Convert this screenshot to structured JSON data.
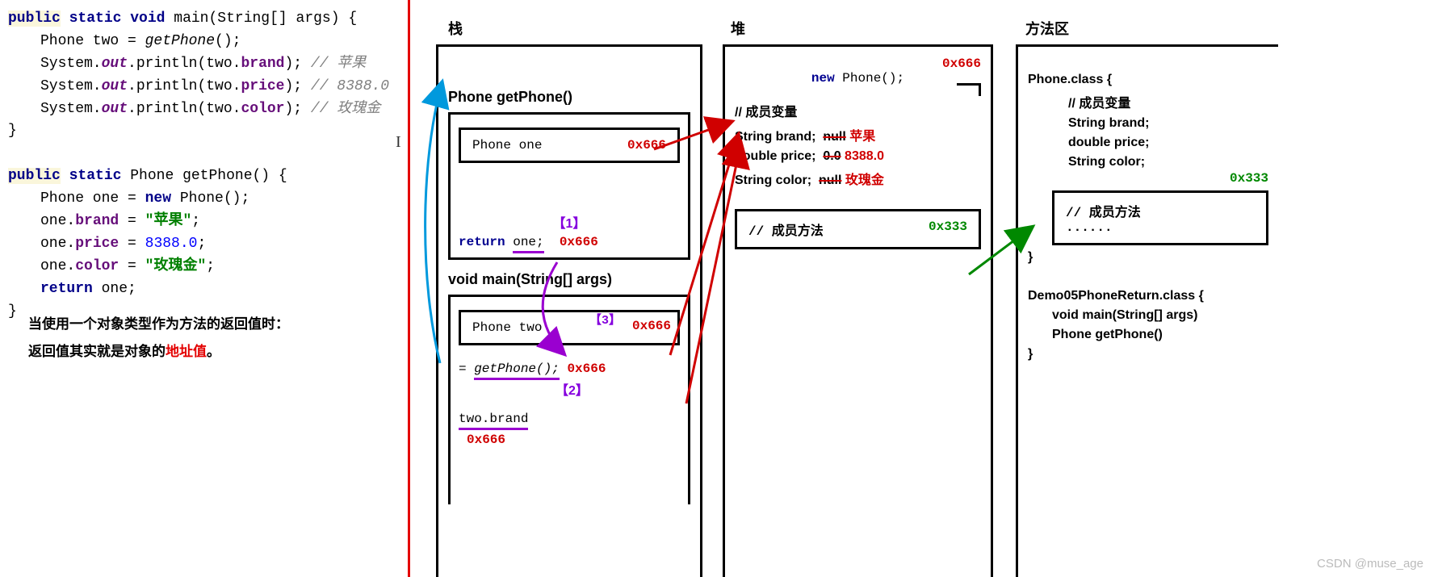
{
  "code": {
    "main_sig": {
      "public": "public",
      "static": "static",
      "void": "void",
      "main": "main",
      "args": "(String[] args) {"
    },
    "l1a": "Phone two = ",
    "l1b": "getPhone",
    "l1c": "();",
    "l2a": "System.",
    "l2out": "out",
    "l2b": ".println(two.",
    "brand": "brand",
    "l2c": "); ",
    "c1": "// 苹果",
    "price": "price",
    "c2": "// 8388.0",
    "color": "color",
    "c3": "// 玫瑰金",
    "close": "}",
    "gp_sig": {
      "public": "public",
      "static": "static",
      "type": "Phone",
      "name": "getPhone",
      "p": "() {"
    },
    "g1a": "Phone one = ",
    "g1new": "new ",
    "g1b": "Phone();",
    "g2a": "one.",
    "g2f": "brand",
    "g2b": " = ",
    "g2v": "\"苹果\"",
    "g2c": ";",
    "g3a": "one.",
    "g3f": "price",
    "g3b": " = ",
    "g3v": "8388.0",
    "g3c": ";",
    "g4a": "one.",
    "g4f": "color",
    "g4b": " = ",
    "g4v": "\"玫瑰金\"",
    "g4c": ";",
    "g5a": "return ",
    "g5b": "one;"
  },
  "note": {
    "l1": "当使用一个对象类型作为方法的返回值时：",
    "l2a": "返回值其实就是对象的",
    "l2b": "地址值",
    "l2c": "。"
  },
  "labels": {
    "stack": "栈",
    "heap": "堆",
    "method_area": "方法区"
  },
  "stack": {
    "gp_title": "Phone getPhone()",
    "one_label": "Phone one",
    "addr": "0x666",
    "step1": "【1】",
    "return": "return ",
    "one": "one;",
    "main_title": "void main(String[] args)",
    "two_label": "Phone two",
    "step3": "【3】",
    "eq": "= ",
    "getphone": "getPhone();",
    "step2": "【2】",
    "twobrand": "two.brand",
    "addr2": "0x666"
  },
  "heap": {
    "new": "new ",
    "phone": "Phone();",
    "addr": "0x666",
    "members_title": "// 成员变量",
    "brand_l": "String brand;",
    "brand_old": "null",
    "brand_new": "苹果",
    "price_l": "double price;",
    "price_old": "0.0",
    "price_new": "8388.0",
    "color_l": "String color;",
    "color_old": "null",
    "color_new": "玫瑰金",
    "methods_title": "// 成员方法",
    "methods_addr": "0x333"
  },
  "ma": {
    "pc_title": "Phone.class {",
    "members": "// 成员变量",
    "brand": "String brand;",
    "price": "double price;",
    "color": "String color;",
    "addr": "0x333",
    "methods": "// 成员方法",
    "dots": "......",
    "close": "}",
    "demo_title": "Demo05PhoneReturn.class {",
    "demo_main": "void main(String[] args)",
    "demo_gp": "Phone getPhone()"
  },
  "watermark": "CSDN @muse_age"
}
